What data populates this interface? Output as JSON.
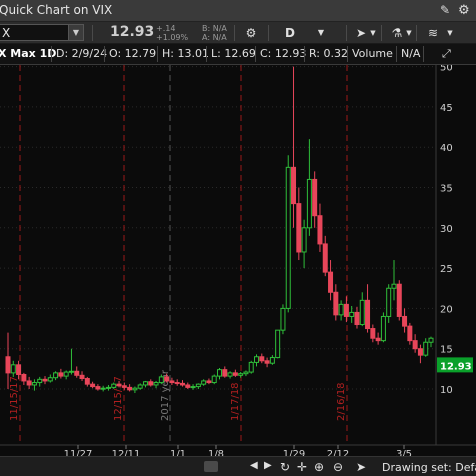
{
  "window": {
    "title": "Quick Chart on VIX"
  },
  "toolbar": {
    "symbol": "X",
    "last": "12.93",
    "change": "+.14",
    "change_pct": "+1.09%",
    "bid": "B: N/A",
    "ask": "A: N/A",
    "period": "D"
  },
  "info": {
    "symbol": "X Max 1D",
    "date": "D: 2/9/24",
    "open": "O: 12.79",
    "high": "H: 13.01",
    "low": "L: 12.69",
    "close": "C: 12.93",
    "range": "R: 0.32",
    "volume_label": "Volume",
    "volume_value": "N/A"
  },
  "price_axis": {
    "ticks": [
      "50",
      "45",
      "40",
      "35",
      "30",
      "25",
      "20",
      "15",
      "10"
    ],
    "last_price": "12.93",
    "last_color": "#0aa02a"
  },
  "time_axis": {
    "labels": [
      "11/27",
      "12/11",
      "1/1",
      "1/8",
      "1/29",
      "2/12",
      "3/5"
    ]
  },
  "expirations": [
    "11/15/17",
    "12/15/17",
    "1/17/18",
    "2/16/18"
  ],
  "year_marker": "2017 year",
  "bottom": {
    "drawing_set": "Drawing set: Defau"
  },
  "colors": {
    "up": "#2fbf3a",
    "down": "#e8465a",
    "expiry": "#9b1a1a",
    "grid": "#2a2a2a"
  },
  "chart_data": {
    "type": "candlestick",
    "ylim": [
      7,
      53
    ],
    "candles": [
      [
        14,
        17,
        10,
        12
      ],
      [
        12,
        13.5,
        11.5,
        13
      ],
      [
        13,
        13.5,
        11.2,
        11.8
      ],
      [
        11.8,
        12,
        10.5,
        11
      ],
      [
        11,
        11.5,
        10,
        10.5
      ],
      [
        10.5,
        11.2,
        9.8,
        10.8
      ],
      [
        10.8,
        11.5,
        10.3,
        11.2
      ],
      [
        11.2,
        11.6,
        10.6,
        11
      ],
      [
        11,
        11.8,
        10.8,
        11.4
      ],
      [
        11.4,
        12.2,
        11.1,
        12
      ],
      [
        12,
        12.5,
        11.3,
        11.6
      ],
      [
        11.6,
        12.3,
        11.2,
        12.1
      ],
      [
        12.1,
        15,
        11.8,
        12.2
      ],
      [
        12.2,
        12.8,
        11.4,
        11.7
      ],
      [
        11.7,
        12.2,
        11,
        11.3
      ],
      [
        11.3,
        11.5,
        10.3,
        10.6
      ],
      [
        10.6,
        10.9,
        10.1,
        10.3
      ],
      [
        10.3,
        10.6,
        9.8,
        10
      ],
      [
        10,
        10.4,
        9.7,
        10.1
      ],
      [
        10.1,
        10.5,
        9.8,
        10.2
      ],
      [
        10.2,
        10.8,
        10,
        10.6
      ],
      [
        10.6,
        11,
        10.2,
        10.4
      ],
      [
        10.4,
        10.8,
        9.9,
        10.2
      ],
      [
        10.2,
        10.6,
        9.7,
        9.9
      ],
      [
        9.9,
        10.3,
        9.5,
        10.1
      ],
      [
        10.1,
        10.7,
        9.9,
        10.5
      ],
      [
        10.5,
        11,
        10.2,
        10.9
      ],
      [
        10.9,
        11.2,
        10.3,
        10.5
      ],
      [
        10.5,
        11,
        10.1,
        10.8
      ],
      [
        10.8,
        11.8,
        10.6,
        11.5
      ],
      [
        11.5,
        11.9,
        10.8,
        11
      ],
      [
        11,
        11.4,
        10.5,
        10.8
      ],
      [
        10.8,
        11.2,
        10.4,
        10.7
      ],
      [
        10.7,
        11.1,
        10.3,
        10.5
      ],
      [
        10.5,
        10.8,
        10,
        10.2
      ],
      [
        10.2,
        10.6,
        9.9,
        10.3
      ],
      [
        10.3,
        10.7,
        10,
        10.6
      ],
      [
        10.6,
        11.2,
        10.4,
        11
      ],
      [
        11,
        11.3,
        10.6,
        10.8
      ],
      [
        10.8,
        11.8,
        10.6,
        11.6
      ],
      [
        11.6,
        12.6,
        11.2,
        12.4
      ],
      [
        12.4,
        12.8,
        11.4,
        11.6
      ],
      [
        11.6,
        12.2,
        11.3,
        12
      ],
      [
        12,
        12.4,
        11.5,
        11.7
      ],
      [
        11.7,
        12.1,
        11.4,
        11.9
      ],
      [
        11.9,
        12.3,
        11.6,
        12.1
      ],
      [
        12.1,
        13.5,
        11.9,
        13.3
      ],
      [
        13.3,
        14.3,
        12.8,
        14
      ],
      [
        14,
        14.4,
        13.2,
        13.5
      ],
      [
        13.5,
        13.9,
        12.7,
        13.2
      ],
      [
        13.2,
        14.2,
        13,
        13.9
      ],
      [
        13.9,
        16.5,
        13.8,
        17.3
      ],
      [
        17.3,
        20.5,
        16.8,
        20
      ],
      [
        20,
        39,
        19.5,
        37.5
      ],
      [
        37.5,
        50,
        30,
        33
      ],
      [
        33,
        35,
        26,
        27
      ],
      [
        27,
        31,
        25,
        30
      ],
      [
        30,
        41,
        29,
        36
      ],
      [
        36,
        37,
        30,
        31.5
      ],
      [
        31.5,
        33,
        27,
        28
      ],
      [
        28,
        29,
        24,
        24.5
      ],
      [
        24.5,
        26,
        21,
        22
      ],
      [
        22,
        23,
        18.5,
        19.2
      ],
      [
        19.2,
        21,
        18.5,
        20.5
      ],
      [
        20.5,
        21.5,
        18.3,
        19
      ],
      [
        19,
        20.3,
        18.2,
        19.5
      ],
      [
        19.5,
        20.2,
        17.5,
        18
      ],
      [
        18,
        22,
        17.8,
        21
      ],
      [
        21,
        23,
        17,
        17.5
      ],
      [
        17.5,
        18,
        15.8,
        16.3
      ],
      [
        16.3,
        17,
        15.5,
        16
      ],
      [
        16,
        19.5,
        15.8,
        19
      ],
      [
        19,
        23,
        18.2,
        22.5
      ],
      [
        22.5,
        26,
        21,
        23
      ],
      [
        23,
        23.5,
        18.5,
        19
      ],
      [
        19,
        20,
        17,
        17.8
      ],
      [
        17.8,
        18.2,
        15.5,
        16
      ],
      [
        16,
        16.8,
        14.5,
        15
      ],
      [
        15,
        15.5,
        13.2,
        14.2
      ],
      [
        14.2,
        16.3,
        14,
        15.8
      ],
      [
        15.8,
        16.5,
        15.2,
        16.3
      ]
    ]
  }
}
